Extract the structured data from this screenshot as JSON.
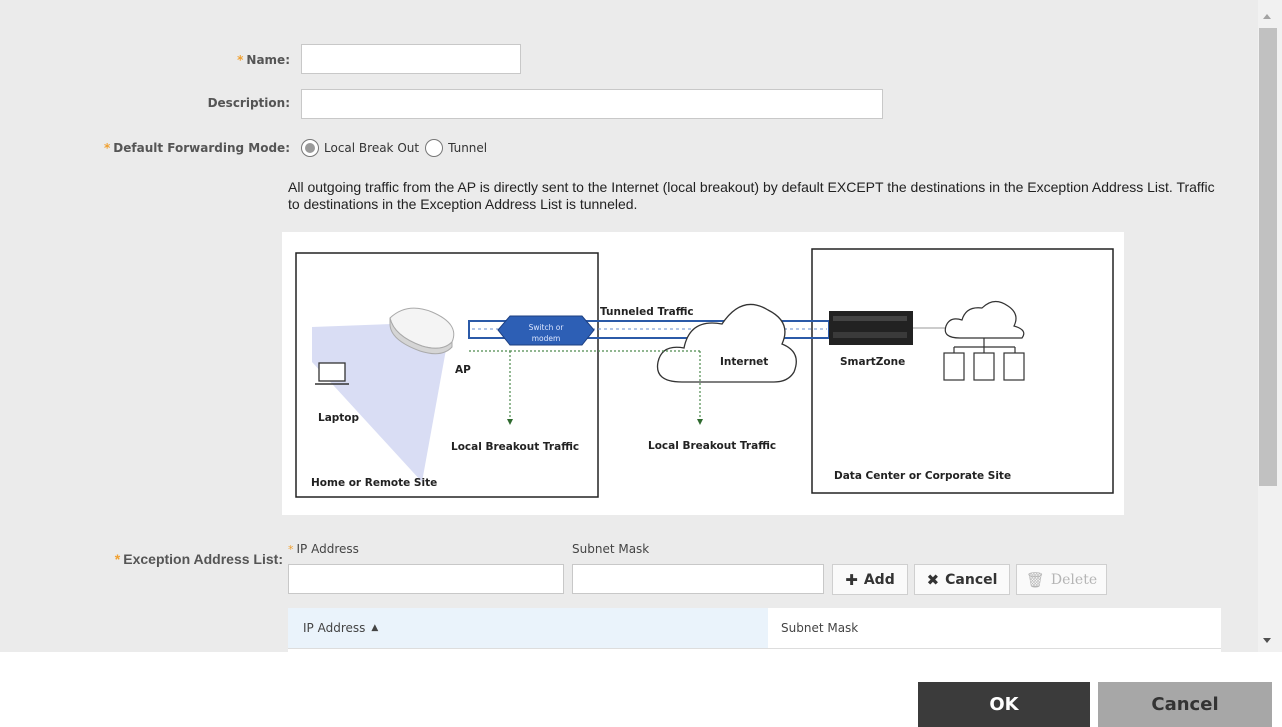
{
  "form": {
    "name_label": "Name:",
    "name_value": "",
    "description_label": "Description:",
    "description_value": "",
    "required_marker": "*",
    "forwarding_label": "Default Forwarding Mode:",
    "forwarding_options": [
      {
        "label": "Local Break Out",
        "checked": true
      },
      {
        "label": "Tunnel",
        "checked": false
      }
    ],
    "help_text": "All outgoing traffic from the AP is directly sent to the Internet (local breakout) by default EXCEPT the destinations in the Exception Address List. Traffic to destinations in the Exception Address List is tunneled."
  },
  "diagram": {
    "tunneled_traffic": "Tunneled Traffic",
    "switch_line1": "Switch or",
    "switch_line2": "modem",
    "internet": "Internet",
    "smartzone": "SmartZone",
    "ap": "AP",
    "laptop": "Laptop",
    "local_breakout_1": "Local Breakout Traffic",
    "local_breakout_2": "Local Breakout Traffic",
    "home_site": "Home or Remote Site",
    "data_center": "Data Center or Corporate Site"
  },
  "exception": {
    "label": "Exception Address List:",
    "ip_label": "IP Address",
    "subnet_label": "Subnet Mask",
    "ip_value": "",
    "subnet_value": "",
    "add_label": "Add",
    "cancel_label": "Cancel",
    "delete_label": "Delete",
    "table_headers": [
      "IP Address",
      "Subnet Mask"
    ],
    "sort_indicator": "▲"
  },
  "footer": {
    "ok_label": "OK",
    "cancel_label": "Cancel"
  },
  "colors": {
    "panel_bg": "#ebebeb",
    "required": "#f0a030",
    "ok_bg": "#3b3b3b",
    "cancel_bg": "#a7a7a7",
    "tunnel_blue": "#2b5aa8"
  },
  "icons": [
    "plus-icon",
    "x-icon",
    "trash-icon",
    "sort-asc-icon"
  ]
}
